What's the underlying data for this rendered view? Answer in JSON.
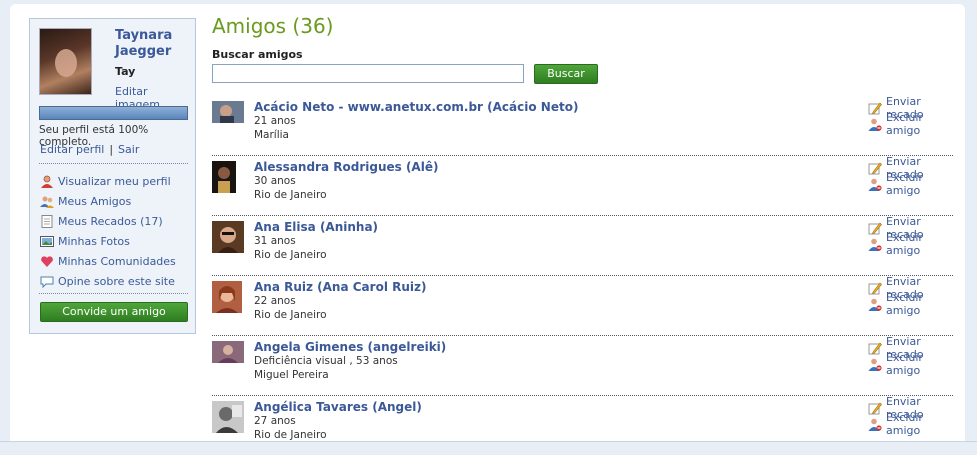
{
  "profile": {
    "name": "Taynara Jaegger",
    "nickname": "Tay",
    "edit_image": "Editar imagem",
    "completion_percent": 100,
    "completion_text": "Seu perfil está 100% completo.",
    "edit_profile": "Editar perfil",
    "logout": "Sair"
  },
  "menu": [
    {
      "label": "Visualizar meu perfil",
      "icon": "user-icon"
    },
    {
      "label": "Meus Amigos",
      "icon": "friends-icon"
    },
    {
      "label": "Meus Recados (17)",
      "icon": "document-icon"
    },
    {
      "label": "Minhas Fotos",
      "icon": "photo-icon"
    },
    {
      "label": "Minhas Comunidades",
      "icon": "heart-icon"
    },
    {
      "label": "Opine sobre este site",
      "icon": "speech-bubble-icon"
    }
  ],
  "invite_button": "Convide um amigo",
  "main": {
    "title": "Amigos (36)",
    "search_label": "Buscar amigos",
    "search_value": "",
    "search_button": "Buscar"
  },
  "actions": {
    "send_message": "Enviar recado",
    "remove_friend": "Excluir amigo"
  },
  "friends": [
    {
      "name": "Acácio Neto - www.anetux.com.br (Acácio Neto)",
      "age": "21 anos",
      "city": "Marília"
    },
    {
      "name": "Alessandra Rodrigues (Alê)",
      "age": "30 anos",
      "city": "Rio de Janeiro"
    },
    {
      "name": "Ana Elisa (Aninha)",
      "age": "31 anos",
      "city": "Rio de Janeiro"
    },
    {
      "name": "Ana Ruiz (Ana Carol Ruiz)",
      "age": "22 anos",
      "city": "Rio de Janeiro"
    },
    {
      "name": "Angela Gimenes (angelreiki)",
      "age": "Deficiência visual , 53 anos",
      "city": "Miguel Pereira"
    },
    {
      "name": "Angélica Tavares (Angel)",
      "age": "27 anos",
      "city": "Rio de Janeiro"
    }
  ],
  "colors": {
    "link": "#3b5998",
    "title_green": "#6a9a1e",
    "button_green": "#3a8d2b"
  }
}
